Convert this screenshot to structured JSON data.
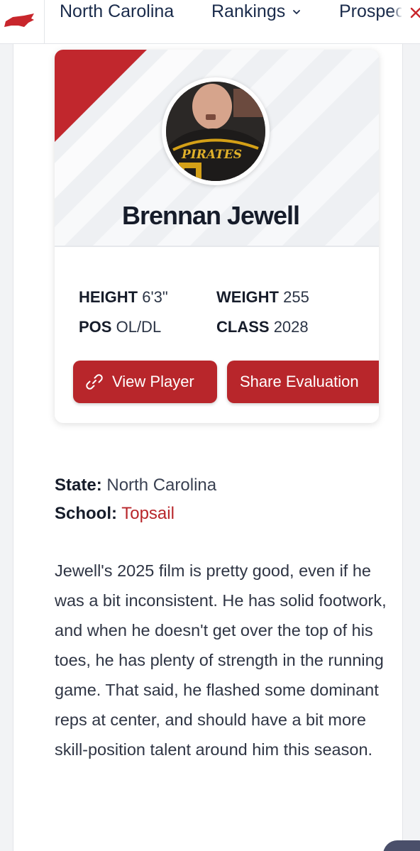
{
  "nav": {
    "state_logo": "north-carolina-state-icon",
    "home_label": "North Carolina",
    "rankings_label": "Rankings",
    "prospects_label": "Prospects",
    "close_icon": "close-icon"
  },
  "player": {
    "name": "Brennan Jewell",
    "avatar": "player-photo",
    "stats": {
      "height_label": "HEIGHT",
      "height_value": "6'3\"",
      "weight_label": "WEIGHT",
      "weight_value": "255",
      "pos_label": "POS",
      "pos_value": "OL/DL",
      "class_label": "CLASS",
      "class_value": "2028"
    },
    "buttons": {
      "view_label": "View Player",
      "view_icon": "link-icon",
      "share_label": "Share Evaluation"
    }
  },
  "meta": {
    "state_label": "State:",
    "state_value": "North Carolina",
    "school_label": "School:",
    "school_value": "Topsail"
  },
  "evaluation": {
    "text": "Jewell's 2025 film is pretty good, even if he was a bit inconsistent. He has solid footwork, and when he doesn't get over the top of his toes, he has plenty of strength in the running game. That said, he flashed some dominant reps at center, and should have a bit more skill-position talent around him this season."
  },
  "colors": {
    "brand_red": "#b8262b",
    "navy": "#1a2b4b"
  }
}
